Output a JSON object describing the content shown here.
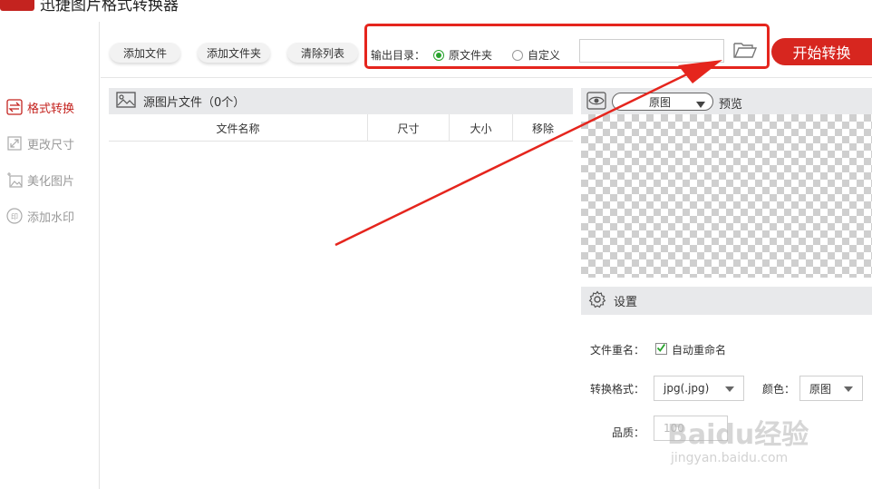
{
  "app": {
    "title": "迅捷图片格式转换器"
  },
  "sidebar": {
    "items": [
      {
        "label": "格式转换",
        "icon": "swap-arrows-icon"
      },
      {
        "label": "更改尺寸",
        "icon": "resize-icon"
      },
      {
        "label": "美化图片",
        "icon": "magic-image-icon"
      },
      {
        "label": "添加水印",
        "icon": "stamp-icon"
      }
    ]
  },
  "toolbar": {
    "add_file": "添加文件",
    "add_folder": "添加文件夹",
    "clear_list": "清除列表",
    "output_label": "输出目录：",
    "radio_original": "原文件夹",
    "radio_custom": "自定义",
    "path_value": "",
    "start": "开始转换"
  },
  "source": {
    "title": "源图片文件（0个）",
    "columns": [
      "文件名称",
      "尺寸",
      "大小",
      "移除"
    ]
  },
  "preview": {
    "mode": "原图",
    "label": "预览"
  },
  "settings": {
    "title": "设置",
    "rename_label": "文件重名：",
    "auto_rename": "自动重命名",
    "format_label": "转换格式：",
    "format_value": "jpg(.jpg)",
    "color_label": "颜色：",
    "color_value": "原图",
    "quality_label": "品质：",
    "quality_value": "100"
  },
  "watermark": {
    "brand": "Baidu经验",
    "url": "jingyan.baidu.com"
  },
  "colors": {
    "accent": "#d7261f",
    "highlight": "#e5251d",
    "radio_on": "#27a32b",
    "panel_header": "#e8e9eb"
  }
}
